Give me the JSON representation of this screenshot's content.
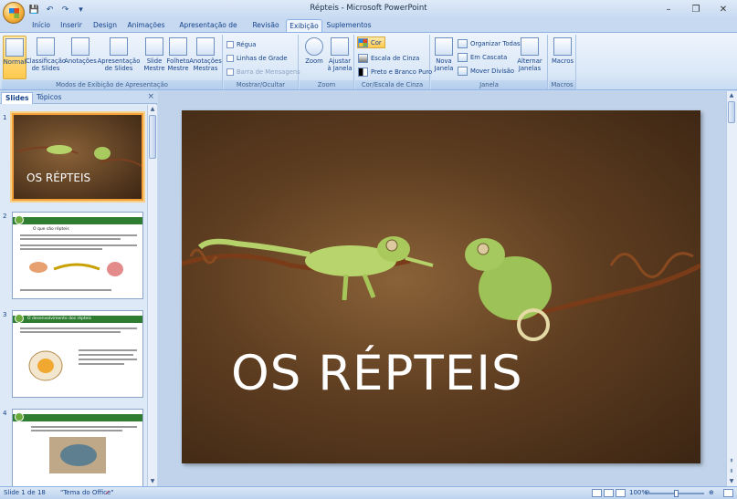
{
  "window": {
    "title": "Répteis - Microsoft PowerPoint",
    "controls": {
      "minimize": "–",
      "maximize": "❐",
      "close": "✕"
    }
  },
  "quick_access": [
    {
      "icon": "save-icon",
      "glyph": "💾"
    },
    {
      "icon": "undo-icon",
      "glyph": "↶"
    },
    {
      "icon": "redo-icon",
      "glyph": "↷"
    },
    {
      "icon": "customize-icon",
      "glyph": "▾"
    }
  ],
  "tabs": [
    "Início",
    "Inserir",
    "Design",
    "Animações",
    "Apresentação de Slides",
    "Revisão",
    "Exibição",
    "Suplementos"
  ],
  "active_tab": "Exibição",
  "ribbon": {
    "groups": {
      "presentation_views": "Modos de Exibição de Apresentação",
      "show_hide": "Mostrar/Ocultar",
      "zoom": "Zoom",
      "color_gray": "Cor/Escala de Cinza",
      "window": "Janela",
      "macros": "Macros"
    },
    "buttons": {
      "normal": "Normal",
      "slide_sorter": "Classificação de Slides",
      "notes": "Anotações",
      "slide_show": "Apresentação de Slides",
      "slide_master": "Slide Mestre",
      "handout_master": "Folheto Mestre",
      "notes_master": "Anotações Mestras",
      "ruler": "Régua",
      "gridlines": "Linhas de Grade",
      "message_bar": "Barra de Mensagens",
      "zoom": "Zoom",
      "fit_window": "Ajustar à Janela",
      "color": "Cor",
      "grayscale": "Escala de Cinza",
      "black_white": "Preto e Branco Puro",
      "new_window": "Nova Janela",
      "arrange_all": "Organizar Todas",
      "cascade": "Em Cascata",
      "move_split": "Mover Divisão",
      "switch_windows": "Alternar Janelas",
      "macros": "Macros"
    }
  },
  "pane": {
    "tabs": [
      "Slides",
      "Tópicos"
    ],
    "close_glyph": "×",
    "thumbnails": [
      {
        "number": "1",
        "title": "OS RÉPTEIS"
      },
      {
        "number": "2",
        "title": "O que são répteis"
      },
      {
        "number": "3",
        "title": "O desenvolvimento dos répteis"
      },
      {
        "number": "4",
        "title": ""
      }
    ]
  },
  "slide": {
    "title": "OS RÉPTEIS"
  },
  "status": {
    "slide_counter": "Slide 1 de 18",
    "theme": "\"Tema do Office\"",
    "zoom": "100%",
    "zoom_level": 0.5
  },
  "colors": {
    "ribbon_bg": "#dbe8f7",
    "accent_orange": "#ffc94d",
    "slide_bg": "#5f3e21",
    "thumb_header_green": "#2f7d31"
  }
}
